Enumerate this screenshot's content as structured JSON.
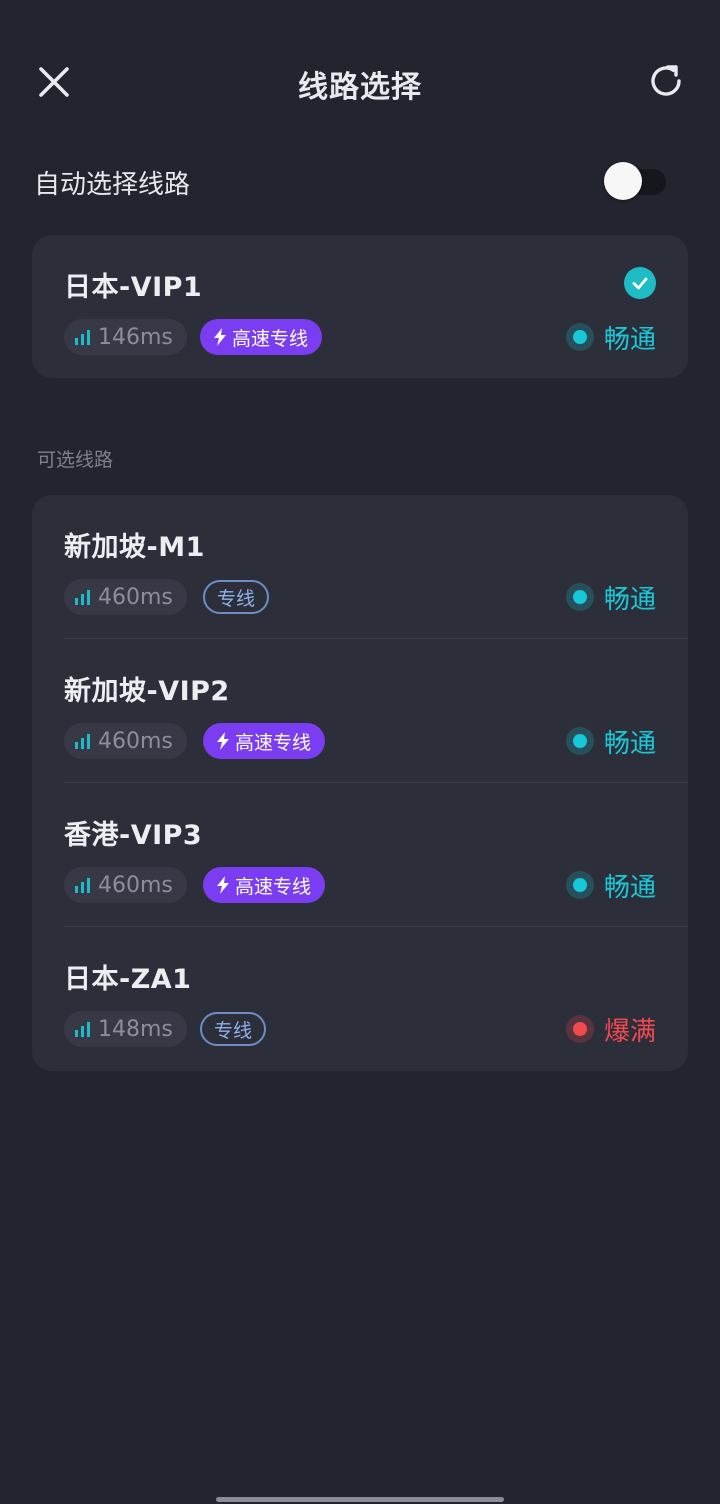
{
  "header": {
    "title": "线路选择",
    "close_icon": "close-icon",
    "refresh_icon": "refresh-icon"
  },
  "auto_select": {
    "label": "自动选择线路",
    "enabled": false
  },
  "current_route": {
    "name": "日本-VIP1",
    "latency": "146ms",
    "tag": "高速专线",
    "tag_type": "fast",
    "status": "畅通",
    "status_type": "ok",
    "selected": true
  },
  "section_label": "可选线路",
  "routes": [
    {
      "name": "新加坡-M1",
      "latency": "460ms",
      "tag": "专线",
      "tag_type": "line",
      "status": "畅通",
      "status_type": "ok"
    },
    {
      "name": "新加坡-VIP2",
      "latency": "460ms",
      "tag": "高速专线",
      "tag_type": "fast",
      "status": "畅通",
      "status_type": "ok"
    },
    {
      "name": "香港-VIP3",
      "latency": "460ms",
      "tag": "高速专线",
      "tag_type": "fast",
      "status": "畅通",
      "status_type": "ok"
    },
    {
      "name": "日本-ZA1",
      "latency": "148ms",
      "tag": "专线",
      "tag_type": "line",
      "status": "爆满",
      "status_type": "full"
    }
  ],
  "colors": {
    "ok": "#19c8d8",
    "full": "#f04a4f",
    "fast_tag": "#7a3df2",
    "accent": "#1fbcc6"
  }
}
